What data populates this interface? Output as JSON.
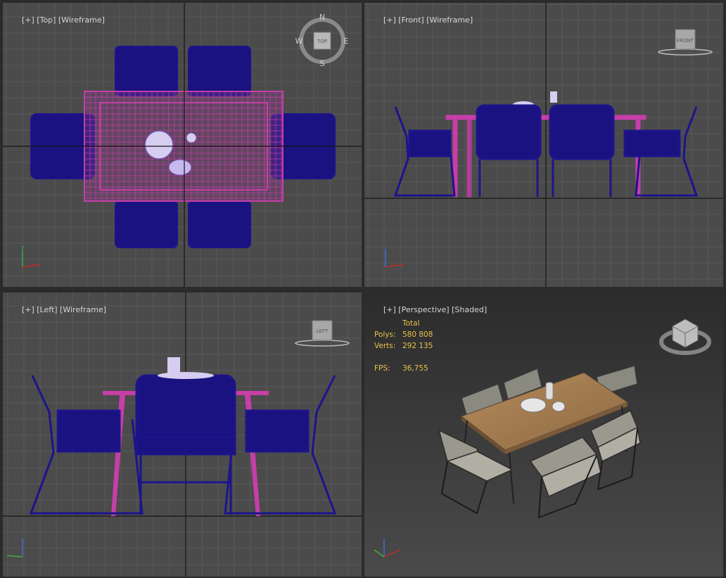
{
  "viewports": {
    "top": {
      "plus": "[+]",
      "view": "[Top]",
      "mode": "[Wireframe]",
      "cube_face": "TOP",
      "compass": {
        "n": "N",
        "s": "S",
        "e": "E",
        "w": "W"
      }
    },
    "front": {
      "plus": "[+]",
      "view": "[Front]",
      "mode": "[Wireframe]",
      "cube_face": "FRONT"
    },
    "left": {
      "plus": "[+]",
      "view": "[Left]",
      "mode": "[Wireframe]",
      "cube_face": "LEFT"
    },
    "perspective": {
      "plus": "[+]",
      "view": "[Perspective]",
      "mode": "[Shaded]"
    }
  },
  "stats": {
    "header": "Total",
    "polys_label": "Polys:",
    "polys_value": "580 808",
    "verts_label": "Verts:",
    "verts_value": "292 135",
    "fps_label": "FPS:",
    "fps_value": "36,755"
  },
  "colors": {
    "viewport_bg": "#4b4b4b",
    "grid": "#5a5a5a",
    "axis_line": "#151515",
    "chair_wire": "#1c148c",
    "table_wire": "#c63ea8",
    "active_border": "#b9a35c",
    "stats_text": "#e8c24a"
  },
  "icons": [
    "viewcube-icon",
    "compass-icon",
    "axis-tripod-icon"
  ]
}
